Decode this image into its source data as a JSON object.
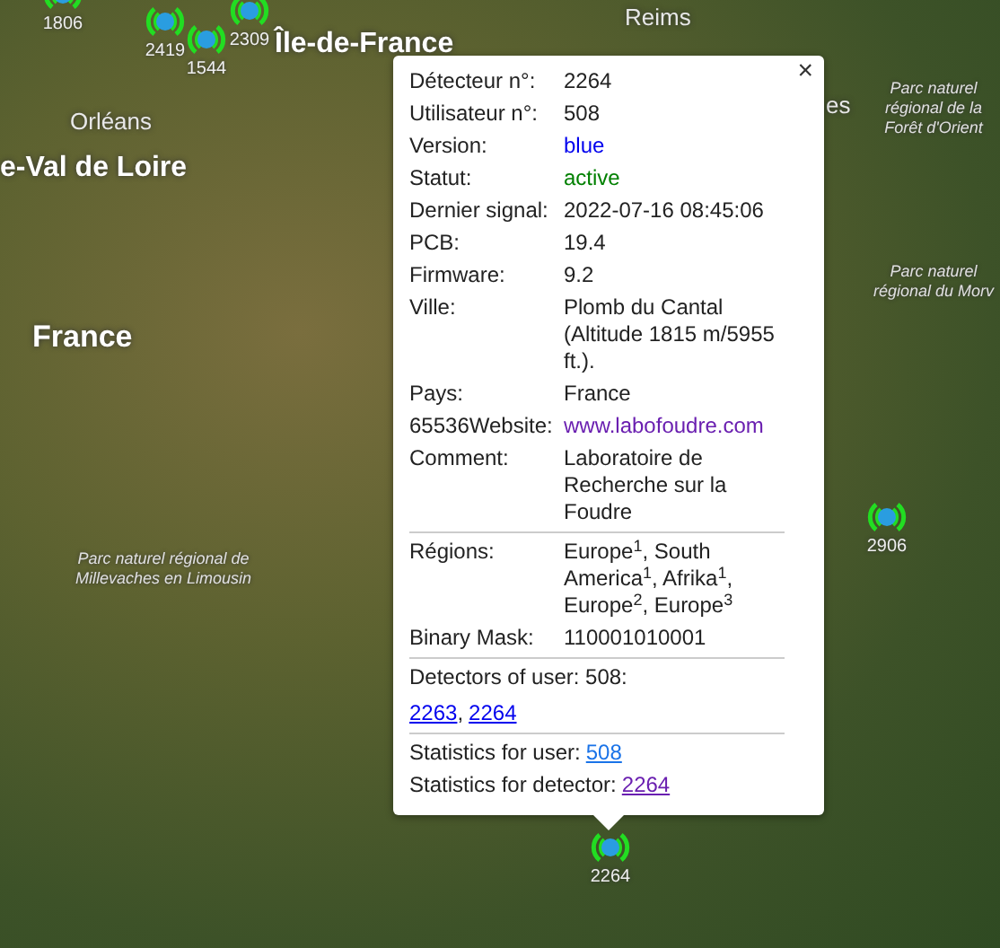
{
  "map": {
    "labels": [
      {
        "text": "Reims",
        "kind": "city"
      },
      {
        "text": "Île-de-France",
        "kind": "region"
      },
      {
        "text": "Orléans",
        "kind": "city"
      },
      {
        "text": "e-Val de Loire",
        "kind": "region"
      },
      {
        "text": "es",
        "kind": "city"
      },
      {
        "text": "France",
        "kind": "country"
      },
      {
        "text": "Parc naturel régional de la Forêt d'Orient",
        "kind": "park"
      },
      {
        "text": "Parc naturel régional du Morv",
        "kind": "park"
      },
      {
        "text": "Parc naturel régional de Millevaches en Limousin",
        "kind": "park"
      }
    ],
    "markers": [
      {
        "label": "1806"
      },
      {
        "label": "2419"
      },
      {
        "label": "1544"
      },
      {
        "label": "2309"
      },
      {
        "label": "2906"
      },
      {
        "label": "2264"
      }
    ]
  },
  "popup": {
    "close": "×",
    "sections": [
      {
        "kind": "rows",
        "rows": [
          {
            "label": "Détecteur n°:",
            "value": "2264",
            "kind": "plain"
          },
          {
            "label": "Utilisateur n°:",
            "value": "508",
            "kind": "plain"
          },
          {
            "label": "Version:",
            "value": "blue",
            "kind": "version"
          },
          {
            "label": "Statut:",
            "value": "active",
            "kind": "status"
          },
          {
            "label": "Dernier signal:",
            "value": "2022-07-16 08:45:06",
            "kind": "plain"
          },
          {
            "label": "PCB:",
            "value": "19.4",
            "kind": "plain"
          },
          {
            "label": "Firmware:",
            "value": "9.2",
            "kind": "plain"
          },
          {
            "label": "Ville:",
            "value": "Plomb du Cantal (Altitude 1815 m/5955 ft.).",
            "kind": "plain"
          },
          {
            "label": "Pays:",
            "value": "France",
            "kind": "plain"
          },
          {
            "label": "65536Website:",
            "value": "www.labofoudre.com",
            "kind": "link"
          },
          {
            "label": "Comment:",
            "value": "Laboratoire de Recherche sur la Foudre",
            "kind": "plain"
          }
        ]
      },
      {
        "kind": "rows",
        "rows": [
          {
            "label": "Régions:",
            "value": "Europe$^{1}$, South America$^{1}$, Afrika$^{1}$, Europe$^{2}$, Europe$^{3}$",
            "kind": "plain"
          },
          {
            "label": "Binary Mask:",
            "value": "110001010001",
            "kind": "plain"
          }
        ]
      },
      {
        "kind": "links",
        "title": "Detectors of user: 508:",
        "separator": ",",
        "links": [
          {
            "text": "2263",
            "visited": false
          },
          {
            "text": "2264",
            "visited": false
          }
        ]
      },
      {
        "kind": "stats",
        "lines": [
          {
            "text": "Statistics for user:",
            "link": "508",
            "visited": false
          },
          {
            "text": "Statistics for detector:",
            "link": "2264",
            "visited": true
          }
        ]
      }
    ]
  }
}
